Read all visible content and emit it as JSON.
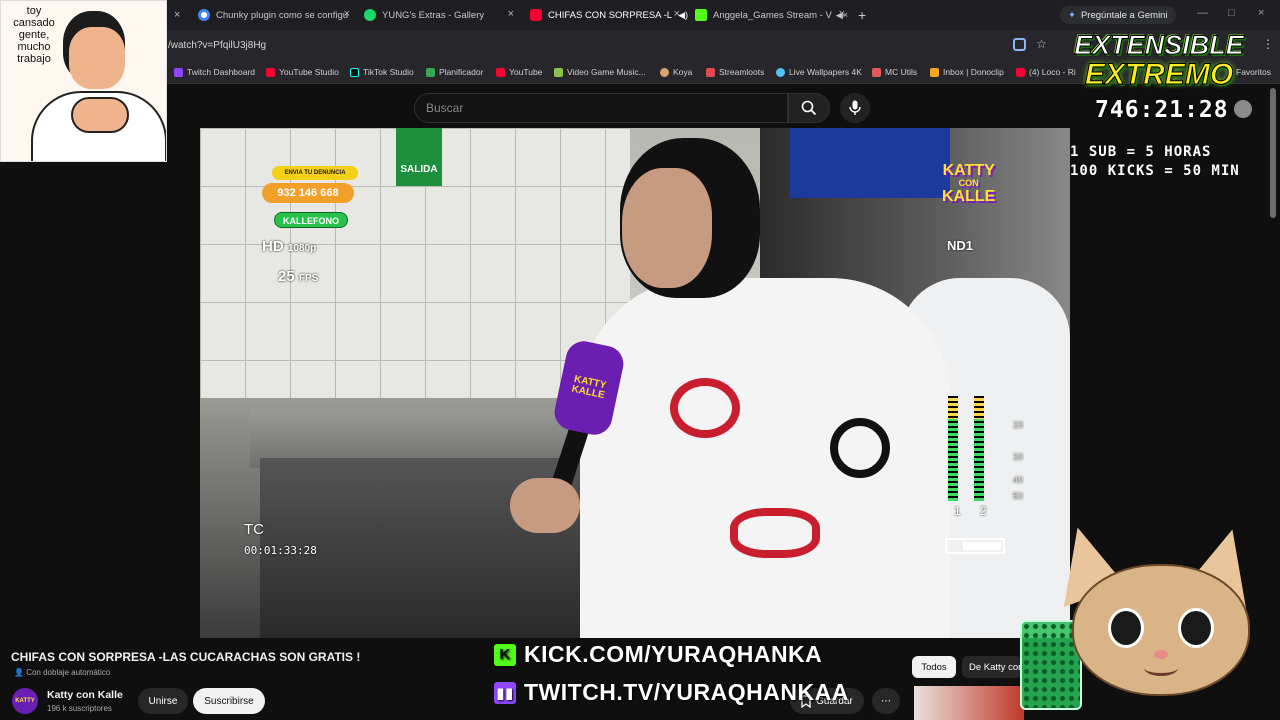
{
  "browser": {
    "tabs": [
      {
        "title": "Chunky plugin como se configu",
        "color": "#4285f4"
      },
      {
        "title": "YUNG's Extras - Gallery",
        "color": "#1bd96a"
      },
      {
        "title": "CHIFAS CON SORPRESA -L",
        "color": "#ff0033"
      },
      {
        "title": "Anggela_Games Stream - V",
        "color": "#53fc18"
      }
    ],
    "new_tab": "+",
    "gemini_label": "Pregúntale a Gemini",
    "url": "/watch?v=PfqilU3j8Hg",
    "bookmarks": [
      "Twitch Dashboard",
      "YouTube Studio",
      "TikTok Studio",
      "Planificador",
      "YouTube",
      "Video Game Music...",
      "Koya",
      "Streamloots",
      "Live Wallpapers 4K",
      "MC Utils",
      "Inbox | Donoclip",
      "(4) Loco - Ri",
      "Favoritos"
    ]
  },
  "youtube": {
    "search_placeholder": "Buscar",
    "video_title": "CHIFAS CON SORPRESA -LAS CUCARACHAS SON GRATIS !",
    "dub_label": "Con doblaje automático",
    "channel_name": "Katty con Kalle",
    "subscribers": "196 k suscriptores",
    "join_label": "Unirse",
    "subscribe_label": "Suscribirse",
    "save_label": "Guardar",
    "more_label": "⋯",
    "chip_all": "Todos",
    "chip_channel": "De Katty con Kalle"
  },
  "video_hud": {
    "report_label": "ENVIA TU DENUNCIA",
    "phone": "932 146 668",
    "kallefono": "KALLEFONO",
    "exit_sign": "SALIDA",
    "resolution": "HD",
    "resolution_detail": "1080p",
    "fps": "25",
    "fps_unit": "FPS",
    "tc_label": "TC",
    "timecode": "00:01:33:28",
    "nd_label": "ND1",
    "show_logo_lines": [
      "KATTY",
      "CON",
      "KALLE"
    ],
    "meter_labels": [
      "20",
      "30",
      "40",
      "50"
    ],
    "channel_numbers": [
      "1",
      "2"
    ],
    "mic_text": "KATTY KALLE"
  },
  "overlay": {
    "meme_text": "toy cansado gente, mucho trabajo",
    "event_title_1": "EXTENSIBLE",
    "event_title_2": "EXTREMO",
    "timer": "746:21:28",
    "rule_1": "1 SUB = 5 HORAS",
    "rule_2": "100 KICKS = 50 MIN",
    "kick_url": "KICK.COM/YURAQHANKA",
    "twitch_url": "TWITCH.TV/YURAQHANKAA",
    "kick_color": "#53fc18",
    "twitch_color": "#9146ff"
  }
}
